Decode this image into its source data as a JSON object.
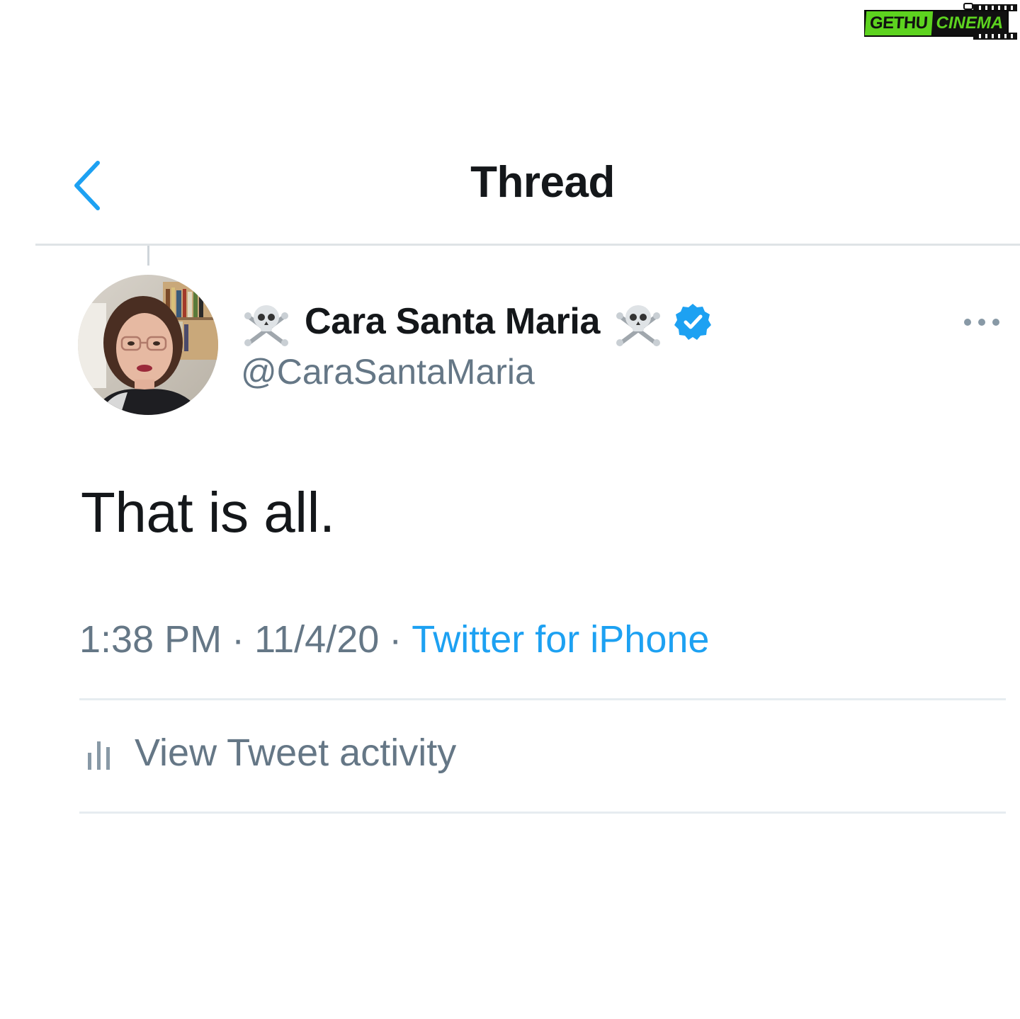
{
  "watermark": {
    "brand_left": "GETHU",
    "brand_right": "CINEMA"
  },
  "header": {
    "title": "Thread",
    "back_icon": "chevron-left-icon",
    "accent_color": "#1da1f2"
  },
  "tweet": {
    "author": {
      "name": "Cara Santa Maria",
      "handle": "@CaraSantaMaria",
      "name_prefix_emoji": "skull-and-crossbones",
      "name_suffix_emoji": "skull-and-crossbones",
      "verified": true,
      "verified_color": "#1da1f2"
    },
    "text": "That is all.",
    "time": "1:38 PM",
    "date": "11/4/20",
    "separator": "·",
    "source": "Twitter for iPhone",
    "more_icon": "more-horizontal-icon"
  },
  "activity": {
    "label": "View Tweet activity",
    "icon": "bar-chart-icon"
  }
}
